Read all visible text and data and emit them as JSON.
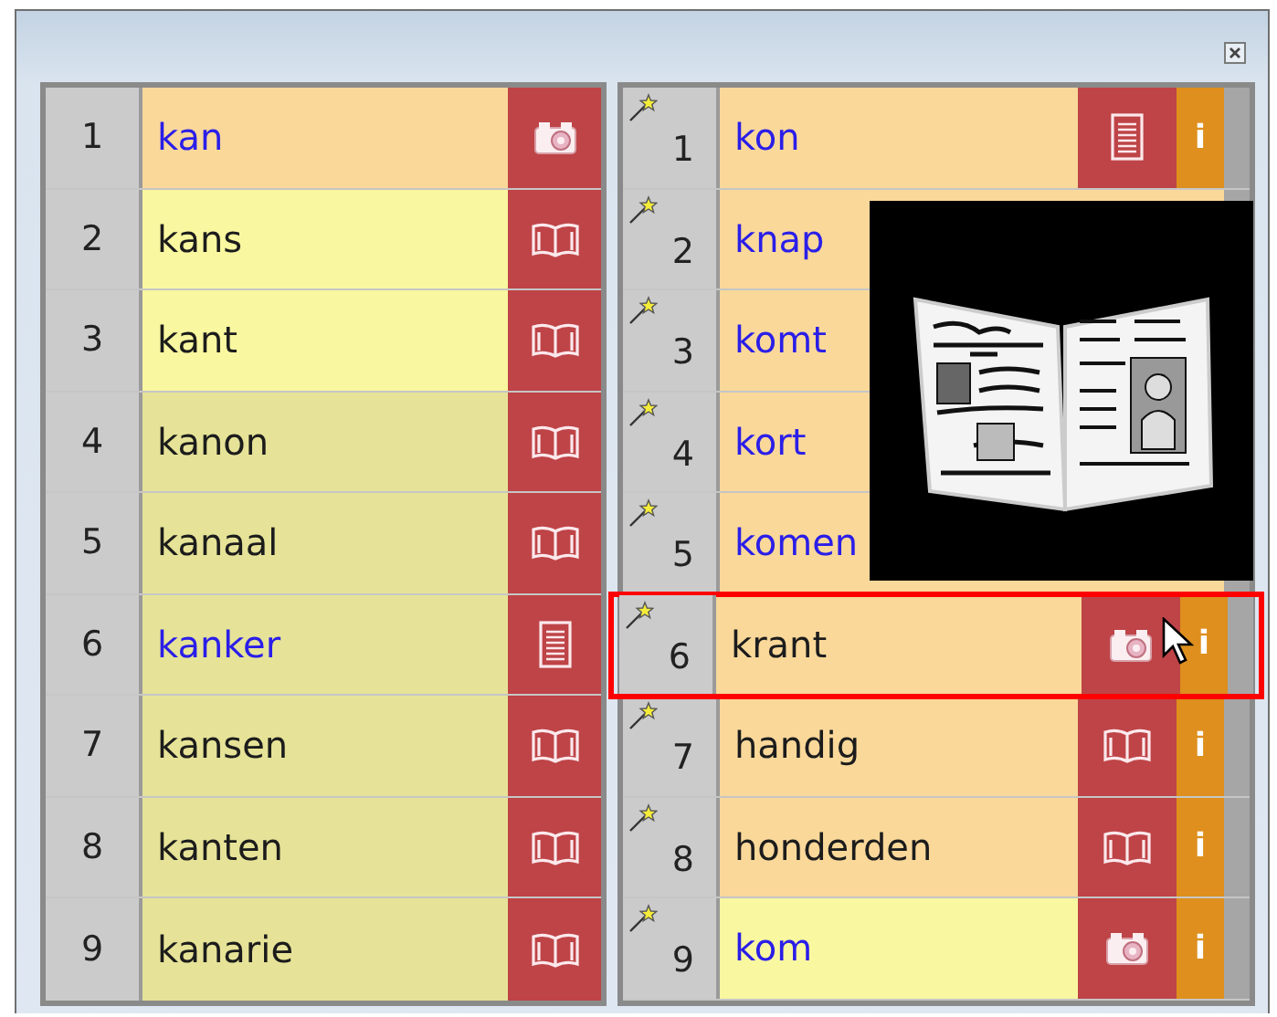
{
  "left_list": {
    "rows": [
      {
        "number": "1",
        "word": "kan",
        "linked": true,
        "color": "#f9d89a",
        "kind": "camera"
      },
      {
        "number": "2",
        "word": "kans",
        "linked": false,
        "color": "#f9f7a0",
        "kind": "book"
      },
      {
        "number": "3",
        "word": "kant",
        "linked": false,
        "color": "#f9f7a0",
        "kind": "book"
      },
      {
        "number": "4",
        "word": "kanon",
        "linked": false,
        "color": "#e6e398",
        "kind": "book"
      },
      {
        "number": "5",
        "word": "kanaal",
        "linked": false,
        "color": "#e6e398",
        "kind": "book"
      },
      {
        "number": "6",
        "word": "kanker",
        "linked": true,
        "color": "#e6e398",
        "kind": "document"
      },
      {
        "number": "7",
        "word": "kansen",
        "linked": false,
        "color": "#e6e398",
        "kind": "book"
      },
      {
        "number": "8",
        "word": "kanten",
        "linked": false,
        "color": "#e6e398",
        "kind": "book"
      },
      {
        "number": "9",
        "word": "kanarie",
        "linked": false,
        "color": "#e6e398",
        "kind": "book"
      }
    ]
  },
  "right_list": {
    "rows": [
      {
        "number": "1",
        "word": "kon",
        "linked": true,
        "color": "#f9d89a",
        "kind": "document",
        "info": "i",
        "selected": false
      },
      {
        "number": "2",
        "word": "knap",
        "linked": true,
        "color": "#f9d89a",
        "selected": false
      },
      {
        "number": "3",
        "word": "komt",
        "linked": true,
        "color": "#f9d89a",
        "selected": false
      },
      {
        "number": "4",
        "word": "kort",
        "linked": true,
        "color": "#f9d89a",
        "selected": false
      },
      {
        "number": "5",
        "word": "komen",
        "linked": true,
        "color": "#f9d89a",
        "selected": false
      },
      {
        "number": "6",
        "word": "krant",
        "linked": false,
        "color": "#f9d89a",
        "kind": "camera",
        "info": "i",
        "selected": true
      },
      {
        "number": "7",
        "word": "handig",
        "linked": false,
        "color": "#f9d89a",
        "kind": "book",
        "info": "i",
        "selected": false
      },
      {
        "number": "8",
        "word": "honderden",
        "linked": false,
        "color": "#f9d89a",
        "kind": "book",
        "info": "i",
        "selected": false
      },
      {
        "number": "9",
        "word": "kom",
        "linked": true,
        "color": "#f9f7a0",
        "kind": "camera",
        "info": "i",
        "selected": false
      }
    ]
  }
}
